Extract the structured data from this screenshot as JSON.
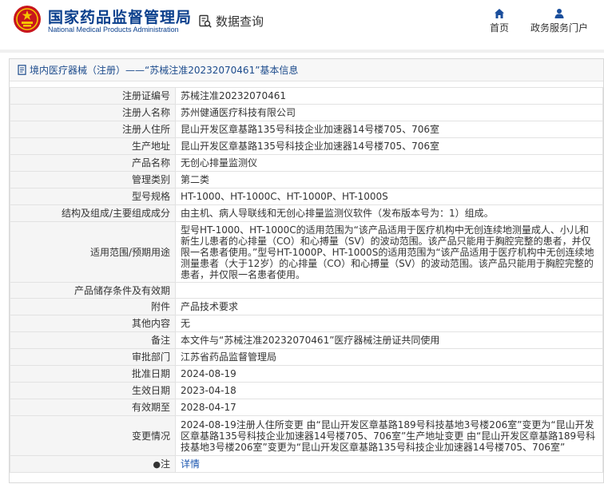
{
  "header": {
    "org_name_cn": "国家药品监督管理局",
    "org_name_en": "National Medical Products Administration",
    "data_query_label": "数据查询",
    "nav": {
      "home_label": "首页",
      "gov_service_label": "政务服务门户"
    }
  },
  "panel": {
    "title": "境内医疗器械（注册）——“苏械注准20232070461”基本信息"
  },
  "rows": [
    {
      "key": "注册证编号",
      "value": "苏械注准20232070461"
    },
    {
      "key": "注册人名称",
      "value": "苏州健通医疗科技有限公司"
    },
    {
      "key": "注册人住所",
      "value": "昆山开发区章基路135号科技企业加速器14号楼705、706室"
    },
    {
      "key": "生产地址",
      "value": "昆山开发区章基路135号科技企业加速器14号楼705、706室"
    },
    {
      "key": "产品名称",
      "value": "无创心排量监测仪"
    },
    {
      "key": "管理类别",
      "value": "第二类"
    },
    {
      "key": "型号规格",
      "value": "HT-1000、HT-1000C、HT-1000P、HT-1000S"
    },
    {
      "key": "结构及组成/主要组成成分",
      "value": "由主机、病人导联线和无创心排量监测仪软件（发布版本号为：1）组成。"
    },
    {
      "key": "适用范围/预期用途",
      "value": "型号HT-1000、HT-1000C的适用范围为“该产品适用于医疗机构中无创连续地测量成人、小儿和新生儿患者的心排量（CO）和心搏量（SV）的波动范围。该产品只能用于胸腔完整的患者，并仅限一名患者使用。”型号HT-1000P、HT-1000S的适用范围为“该产品适用于医疗机构中无创连续地测量患者（大于12岁）的心排量（CO）和心搏量（SV）的波动范围。该产品只能用于胸腔完整的患者，并仅限一名患者使用。"
    },
    {
      "key": "产品储存条件及有效期",
      "value": ""
    },
    {
      "key": "附件",
      "value": "产品技术要求"
    },
    {
      "key": "其他内容",
      "value": "无"
    },
    {
      "key": "备注",
      "value": "本文件与“苏械注准20232070461”医疗器械注册证共同使用"
    },
    {
      "key": "审批部门",
      "value": "江苏省药品监督管理局"
    },
    {
      "key": "批准日期",
      "value": "2024-08-19"
    },
    {
      "key": "生效日期",
      "value": "2023-04-18"
    },
    {
      "key": "有效期至",
      "value": "2028-04-17"
    },
    {
      "key": "变更情况",
      "value": "2024-08-19注册人住所变更 由“昆山开发区章基路189号科技基地3号楼206室”变更为“昆山开发区章基路135号科技企业加速器14号楼705、706室”生产地址变更 由“昆山开发区章基路189号科技基地3号楼206室”变更为“昆山开发区章基路135号科技企业加速器14号楼705、706室”"
    }
  ],
  "note_row": {
    "key": "注",
    "bullet": "●",
    "link_label": "详情"
  }
}
